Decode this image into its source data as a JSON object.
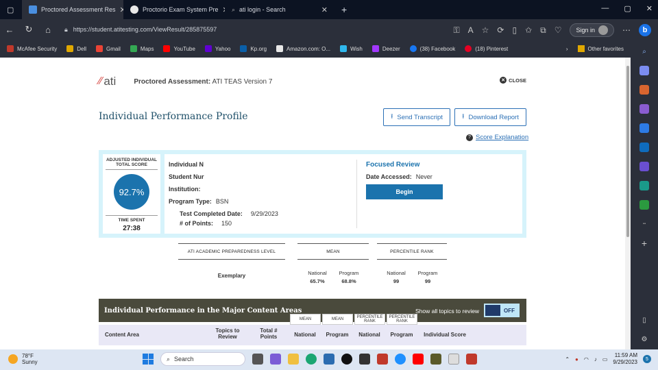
{
  "browser": {
    "tabs": [
      {
        "label": "Proctored Assessment Res",
        "active": true
      },
      {
        "label": "Proctorio Exam System Pre",
        "active": false
      },
      {
        "label": "ati login - Search",
        "active": false
      }
    ],
    "url": "https://student.atitesting.com/ViewResult/285875597",
    "signin_label": "Sign in",
    "bookmarks": [
      "McAfee Security",
      "Dell",
      "Gmail",
      "Maps",
      "YouTube",
      "Yahoo",
      "Kp.org",
      "Amazon.com: O...",
      "Wish",
      "Deezer",
      "(38) Facebook",
      "(18) Pinterest"
    ],
    "other_favorites": "Other favorites"
  },
  "header": {
    "logo_text": "ati",
    "assessment_label": "Proctored Assessment:",
    "assessment_name": "ATI TEAS Version 7",
    "close_label": "CLOSE"
  },
  "page": {
    "title": "Individual Performance Profile",
    "send_transcript": "Send Transcript",
    "download_report": "Download Report",
    "score_explanation": "Score Explanation"
  },
  "profile": {
    "adjusted_label": "ADJUSTED INDIVIDUAL TOTAL SCORE",
    "score": "92.7%",
    "time_spent_label": "TIME SPENT",
    "time_spent": "27:38",
    "individual_name_label": "Individual N",
    "student_number_label": "Student Nur",
    "institution_label": "Institution:",
    "program_type_label": "Program Type:",
    "program_type": "BSN",
    "test_completed_label": "Test Completed Date:",
    "test_completed": "9/29/2023",
    "points_label": "# of Points:",
    "points": "150"
  },
  "focused_review": {
    "title": "Focused Review",
    "date_accessed_label": "Date Accessed:",
    "date_accessed": "Never",
    "begin_label": "Begin"
  },
  "preparedness": {
    "level_header": "ATI ACADEMIC PREPAREDNESS LEVEL",
    "mean_header": "MEAN",
    "percentile_header": "PERCENTILE RANK",
    "level": "Exemplary",
    "national_label": "National",
    "program_label": "Program",
    "mean_national": "65.7%",
    "mean_program": "68.8%",
    "pr_national": "99",
    "pr_program": "99"
  },
  "major_areas": {
    "title": "Individual Performance in the Major Content Areas",
    "show_all_label": "Show all topics to review",
    "toggle_state": "OFF",
    "tab_mean_1": "MEAN",
    "tab_mean_2": "MEAN",
    "tab_pr_1": "PERCENTILE RANK",
    "tab_pr_2": "PERCENTILE RANK",
    "col_content_area": "Content Area",
    "col_topics": "Topics to Review",
    "col_total_points": "Total # Points",
    "col_national_1": "National",
    "col_program_1": "Program",
    "col_national_2": "National",
    "col_program_2": "Program",
    "col_individual_score": "Individual Score"
  },
  "taskbar": {
    "temperature": "78°F",
    "condition": "Sunny",
    "search_label": "Search",
    "time": "11:59 AM",
    "date": "9/29/2023",
    "notification_count": "5"
  },
  "colors": {
    "accent": "#1b73ad",
    "band": "#4a4a3c",
    "profile_bg": "#d6f3fb"
  }
}
